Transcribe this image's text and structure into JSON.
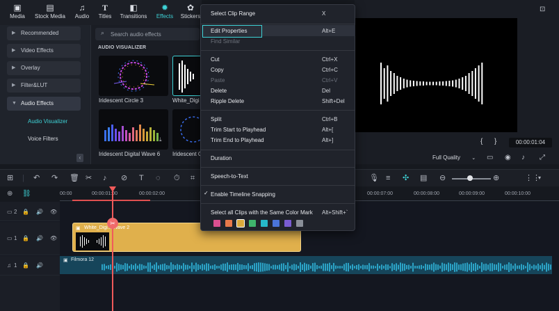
{
  "toolbar": {
    "items": [
      {
        "label": "Media",
        "icon": "media-icon"
      },
      {
        "label": "Stock Media",
        "icon": "stock-media-icon"
      },
      {
        "label": "Audio",
        "icon": "music-note-icon"
      },
      {
        "label": "Titles",
        "icon": "titles-icon"
      },
      {
        "label": "Transitions",
        "icon": "transitions-icon"
      },
      {
        "label": "Effects",
        "icon": "effects-icon"
      },
      {
        "label": "Stickers",
        "icon": "stickers-icon"
      }
    ],
    "active": "Effects",
    "accent": "#3ed2d6"
  },
  "sidebar": {
    "items": [
      {
        "label": "Recommended"
      },
      {
        "label": "Video Effects"
      },
      {
        "label": "Overlay"
      },
      {
        "label": "Filter&LUT"
      },
      {
        "label": "Audio Effects"
      }
    ],
    "subitems": [
      {
        "label": "Audio Visualizer"
      },
      {
        "label": "Voice Filters"
      }
    ]
  },
  "assets": {
    "search_placeholder": "Search audio effects",
    "section_title": "AUDIO VISUALIZER",
    "cards": [
      {
        "label": "Iridescent Circle 3"
      },
      {
        "label": "White_Digi"
      },
      {
        "label": "Iridescent Digital Wave 6"
      },
      {
        "label": "Iridescent C"
      }
    ]
  },
  "preview": {
    "timecode": "00:00:01:04",
    "quality": "Full Quality",
    "brackets": [
      "{",
      "}"
    ]
  },
  "ruler": {
    "labels": [
      "00:00",
      "00:00:01:00",
      "00:00:02:00",
      "00:00:07:00",
      "00:00:08:00",
      "00:00:09:00",
      "00:00:10:00"
    ]
  },
  "tracks": {
    "video2_num": "2",
    "video1_num": "1",
    "audio_num": "1",
    "video_clip_label": "White_Digi... Wave 2",
    "audio_clip_label": "Filmora 12"
  },
  "context_menu": {
    "items": [
      {
        "label": "Select Clip Range",
        "shortcut": "X",
        "disabled": false
      },
      {
        "label": "Edit Properties",
        "shortcut": "Alt+E",
        "disabled": false,
        "highlighted": true
      },
      {
        "label": "Find Similar",
        "shortcut": "",
        "disabled": true
      },
      {
        "label": "Cut",
        "shortcut": "Ctrl+X",
        "disabled": false
      },
      {
        "label": "Copy",
        "shortcut": "Ctrl+C",
        "disabled": false
      },
      {
        "label": "Paste",
        "shortcut": "Ctrl+V",
        "disabled": true
      },
      {
        "label": "Delete",
        "shortcut": "Del",
        "disabled": false
      },
      {
        "label": "Ripple Delete",
        "shortcut": "Shift+Del",
        "disabled": false
      },
      {
        "label": "Split",
        "shortcut": "Ctrl+B",
        "disabled": false
      },
      {
        "label": "Trim Start to Playhead",
        "shortcut": "Alt+[",
        "disabled": false
      },
      {
        "label": "Trim End to Playhead",
        "shortcut": "Alt+]",
        "disabled": false
      },
      {
        "label": "Duration",
        "shortcut": "",
        "disabled": false
      },
      {
        "label": "Speech-to-Text",
        "shortcut": "",
        "disabled": false
      },
      {
        "label": "Enable Timeline Snapping",
        "shortcut": "",
        "disabled": false,
        "checked": true
      },
      {
        "label": "Select all Clips with the Same Color Mark",
        "shortcut": "Alt+Shift+`",
        "disabled": false
      }
    ],
    "check_mark": "✓",
    "color_marks": [
      "#d94f8f",
      "#e8794a",
      "#d9a93c",
      "#3fb56c",
      "#26b8c9",
      "#4a74d9",
      "#7a5cd1",
      "#8a8f98"
    ]
  }
}
